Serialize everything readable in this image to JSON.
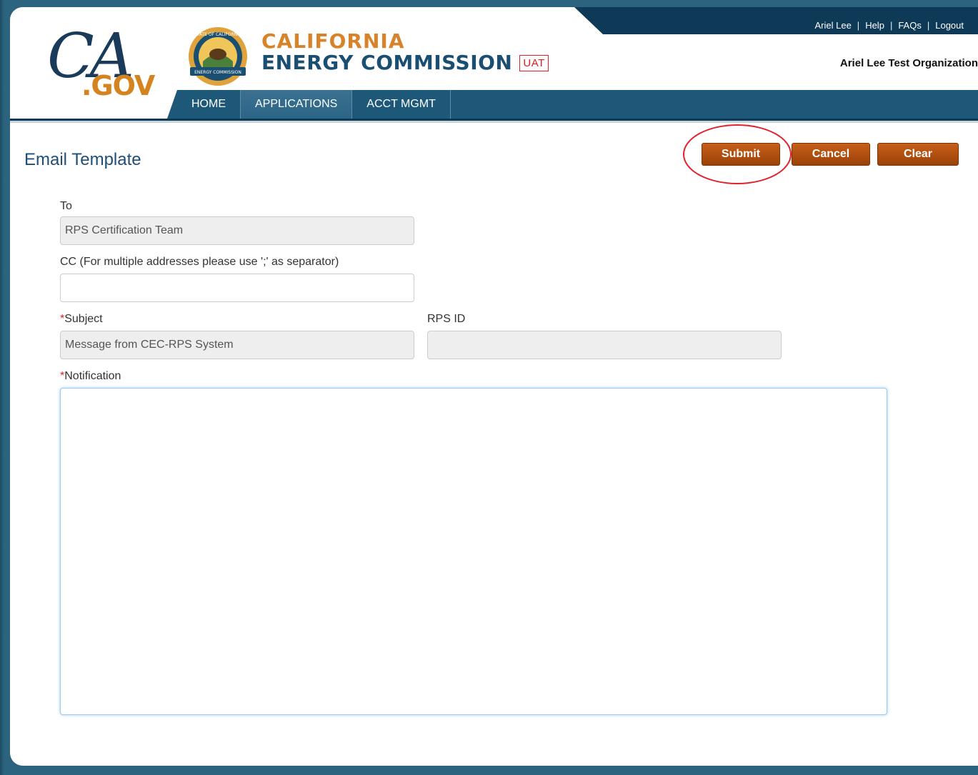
{
  "header": {
    "logo_script": "CA",
    "logo_gov": ".GOV",
    "agency_line1": "CALIFORNIA",
    "agency_line2": "ENERGY COMMISSION",
    "env_badge": "UAT",
    "seal_text_top": "STATE OF CALIFORNIA",
    "seal_text_bottom": "ENERGY COMMISSION",
    "top_links": [
      "Ariel Lee",
      "Help",
      "FAQs",
      "Logout"
    ],
    "organization": "Ariel Lee Test Organization"
  },
  "nav": [
    "HOME",
    "APPLICATIONS",
    "ACCT MGMT"
  ],
  "page": {
    "title": "Email Template",
    "buttons": {
      "submit": "Submit",
      "cancel": "Cancel",
      "clear": "Clear"
    }
  },
  "form": {
    "to_label": "To",
    "to_value": "RPS Certification Team",
    "cc_label": "CC (For multiple addresses please use ';' as separator)",
    "cc_value": "",
    "required_mark": "*",
    "subject_label": "Subject",
    "subject_value": "Message from CEC-RPS System",
    "rpsid_label": "RPS ID",
    "rpsid_value": "",
    "notification_label": "Notification",
    "notification_value": ""
  },
  "colors": {
    "navy": "#0e3a57",
    "nav_blue": "#1e5878",
    "accent_orange": "#d7832a",
    "button_brown": "#a8480c",
    "annotation_red": "#e0232b"
  }
}
